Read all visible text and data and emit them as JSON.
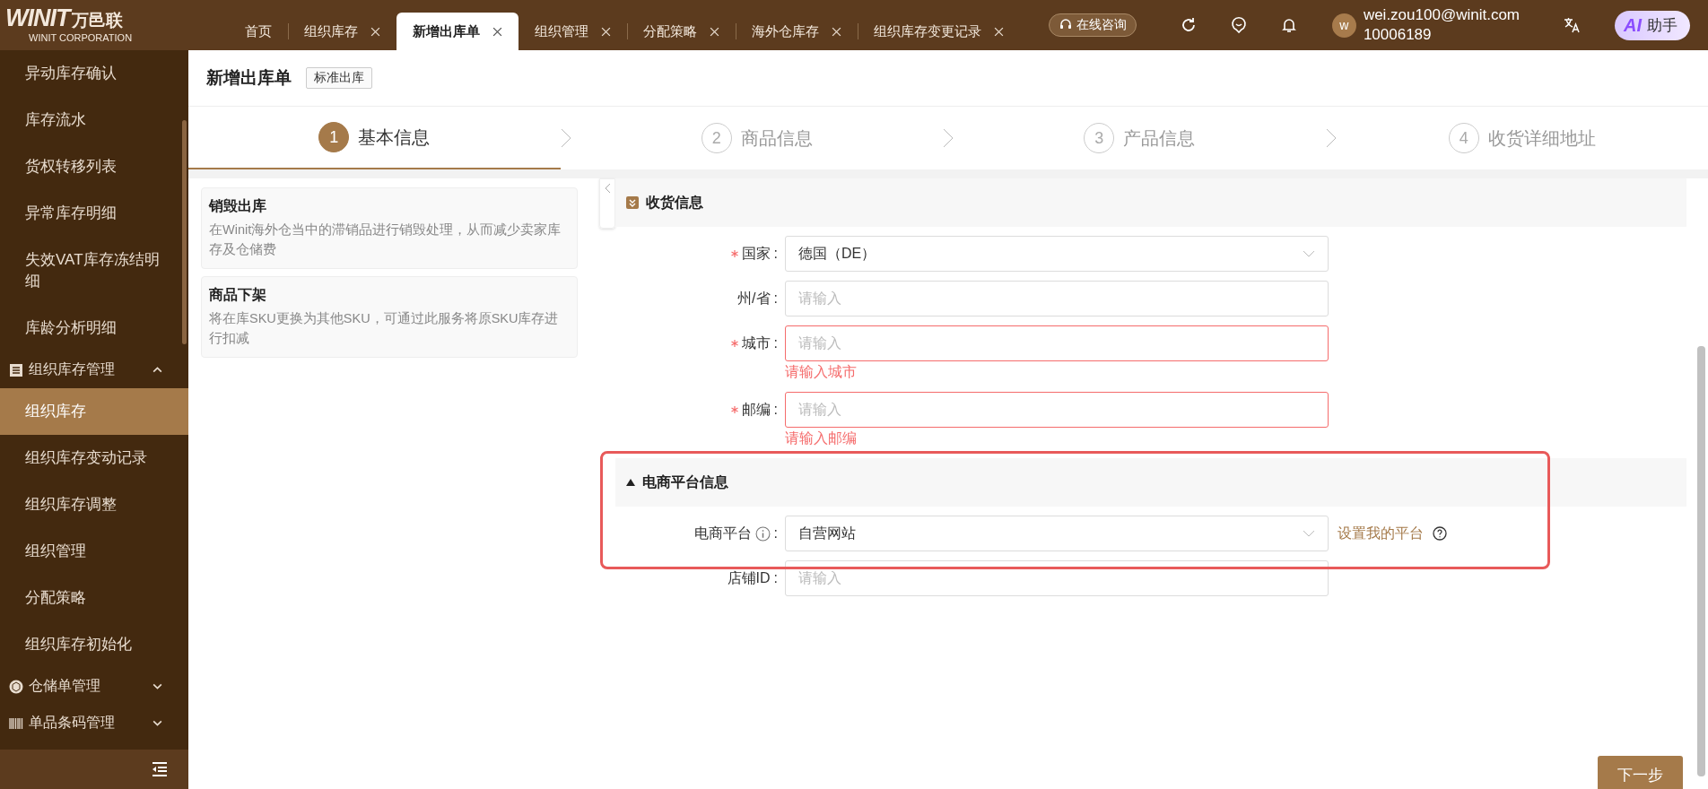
{
  "header": {
    "logo_mark": "W",
    "logo_text": "INIT",
    "logo_cn": "万邑联",
    "logo_sub": "WINIT CORPORATION"
  },
  "tabs": [
    {
      "label": "首页",
      "selected": false,
      "closable": false
    },
    {
      "label": "组织库存",
      "selected": false,
      "closable": true
    },
    {
      "label": "新增出库单",
      "selected": true,
      "closable": true
    },
    {
      "label": "组织管理",
      "selected": false,
      "closable": true
    },
    {
      "label": "分配策略",
      "selected": false,
      "closable": true
    },
    {
      "label": "海外仓库存",
      "selected": false,
      "closable": true
    },
    {
      "label": "组织库存变更记录",
      "selected": false,
      "closable": true
    }
  ],
  "toolbar": {
    "consult": "在线咨询",
    "avatar": "w",
    "email": "wei.zou100@winit.com",
    "user_id": "10006189",
    "ai_badge": "AI",
    "ai_label": "助手"
  },
  "sidebar": {
    "items": [
      {
        "kind": "link",
        "label": "异动库存确认",
        "selected": false
      },
      {
        "kind": "link",
        "label": "库存流水",
        "selected": false
      },
      {
        "kind": "link",
        "label": "货权转移列表",
        "selected": false
      },
      {
        "kind": "link",
        "label": "异常库存明细",
        "selected": false
      },
      {
        "kind": "link",
        "label": "失效VAT库存冻结明细",
        "selected": false
      },
      {
        "kind": "link",
        "label": "库龄分析明细",
        "selected": false
      },
      {
        "kind": "group",
        "label": "组织库存管理",
        "expanded": true,
        "children": [
          {
            "label": "组织库存",
            "selected": true
          },
          {
            "label": "组织库存变动记录",
            "selected": false
          },
          {
            "label": "组织库存调整",
            "selected": false
          },
          {
            "label": "组织管理",
            "selected": false
          },
          {
            "label": "分配策略",
            "selected": false
          },
          {
            "label": "组织库存初始化",
            "selected": false
          }
        ]
      },
      {
        "kind": "group",
        "label": "仓储单管理",
        "expanded": false
      },
      {
        "kind": "group",
        "label": "单品条码管理",
        "expanded": false
      }
    ]
  },
  "page": {
    "title": "新增出库单",
    "tag": "标准出库"
  },
  "steps": [
    {
      "number": "1",
      "label": "基本信息",
      "selected": true
    },
    {
      "number": "2",
      "label": "商品信息",
      "selected": false
    },
    {
      "number": "3",
      "label": "产品信息",
      "selected": false
    },
    {
      "number": "4",
      "label": "收货详细地址",
      "selected": false
    }
  ],
  "services": [
    {
      "title": "销毁出库",
      "description": "在Winit海外仓当中的滞销品进行销毁处理，从而减少卖家库存及仓储费"
    },
    {
      "title": "商品下架",
      "description": "将在库SKU更换为其他SKU，可通过此服务将原SKU库存进行扣减"
    }
  ],
  "sections": [
    {
      "title": "收货信息",
      "expanded": true,
      "highlighted": false,
      "fields": [
        {
          "label": "国家",
          "colon": ":",
          "required": true,
          "kind": "select",
          "value": "德国（DE）"
        },
        {
          "label": "州/省",
          "colon": ":",
          "required": false,
          "kind": "input",
          "placeholder": "请输入"
        },
        {
          "label": "城市",
          "colon": ":",
          "required": true,
          "kind": "input",
          "placeholder": "请输入",
          "error": "请输入城市"
        },
        {
          "label": "邮编",
          "colon": ":",
          "required": true,
          "kind": "input",
          "placeholder": "请输入",
          "error": "请输入邮编"
        }
      ]
    },
    {
      "title": "电商平台信息",
      "expanded": true,
      "highlighted": true,
      "fields": [
        {
          "label": "电商平台",
          "colon": ":",
          "required": false,
          "info": true,
          "kind": "select",
          "value": "自营网站",
          "link": "设置我的平台"
        },
        {
          "label": "店铺ID",
          "colon": ":",
          "required": false,
          "kind": "input",
          "placeholder": "请输入"
        }
      ]
    }
  ],
  "next_button": "下一步"
}
